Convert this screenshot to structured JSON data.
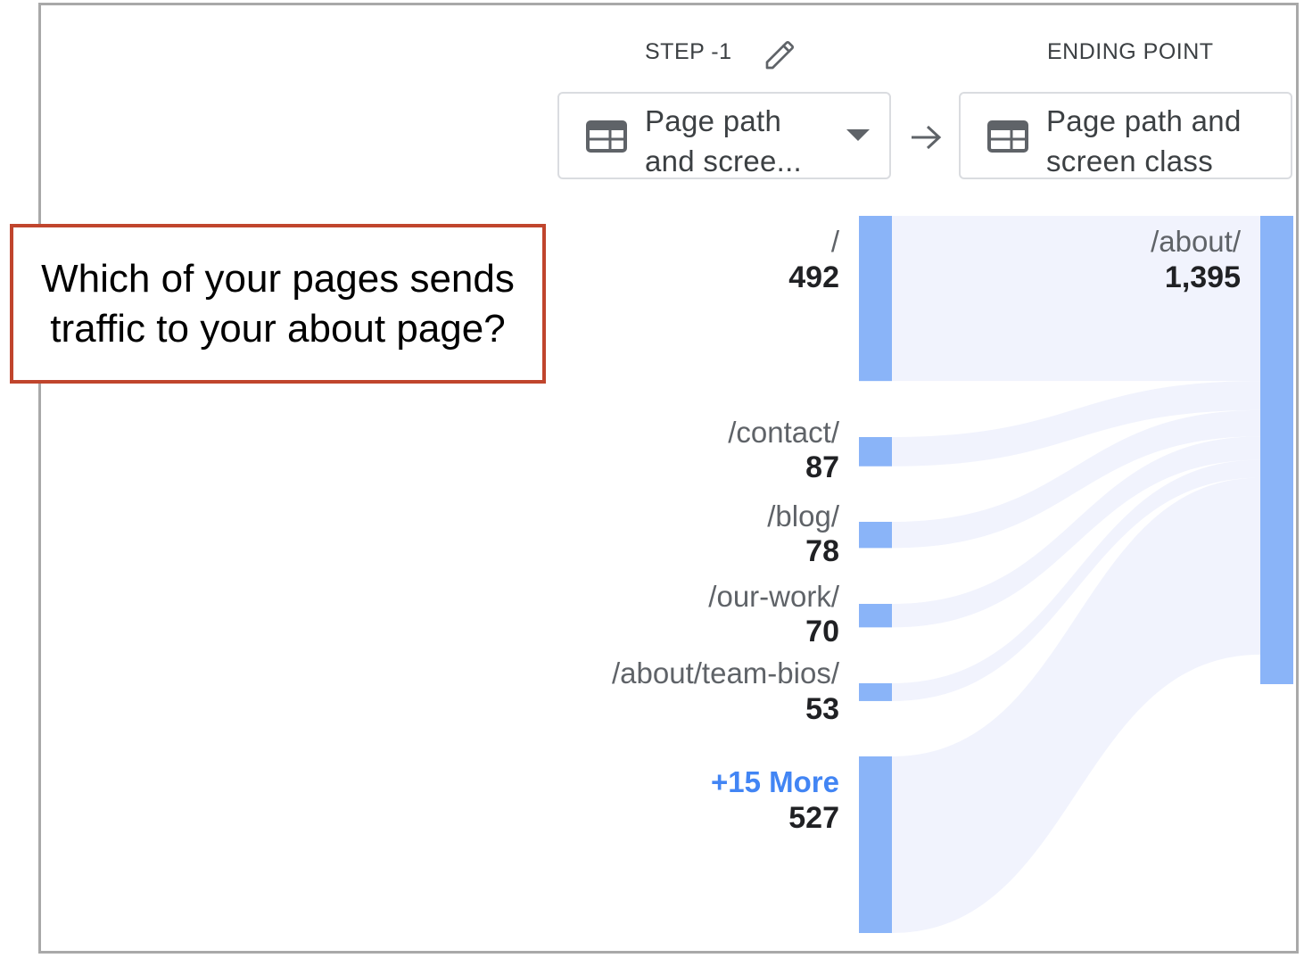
{
  "callout": {
    "text_line1": "Which of your pages sends",
    "text_line2": "traffic to your about page?"
  },
  "step": {
    "label": "STEP -1",
    "edit_icon": "pencil-icon",
    "dimension": "Page path and scree...",
    "dimension_line1": "Page path",
    "dimension_line2": "and scree...",
    "dimension_icon": "table-icon"
  },
  "ending_point": {
    "label": "ENDING POINT",
    "dimension_line1": "Page path and",
    "dimension_line2": "screen class",
    "dimension_icon": "table-icon"
  },
  "connector_icon": "arrow-right-icon",
  "colors": {
    "node": "#8ab4f8",
    "flow": "#f1f3fd",
    "more_link": "#4285f4",
    "callout_border": "#c0452d"
  },
  "chart_data": {
    "type": "sankey",
    "source_nodes": [
      {
        "label": "/",
        "value": 492,
        "display_value": "492"
      },
      {
        "label": "/contact/",
        "value": 87,
        "display_value": "87"
      },
      {
        "label": "/blog/",
        "value": 78,
        "display_value": "78"
      },
      {
        "label": "/our-work/",
        "value": 70,
        "display_value": "70"
      },
      {
        "label": "/about/team-bios/",
        "value": 53,
        "display_value": "53"
      },
      {
        "label": "+15 More",
        "value": 527,
        "display_value": "527",
        "is_more": true
      }
    ],
    "target_node": {
      "label": "/about/",
      "value": 1395,
      "display_value": "1,395"
    }
  }
}
